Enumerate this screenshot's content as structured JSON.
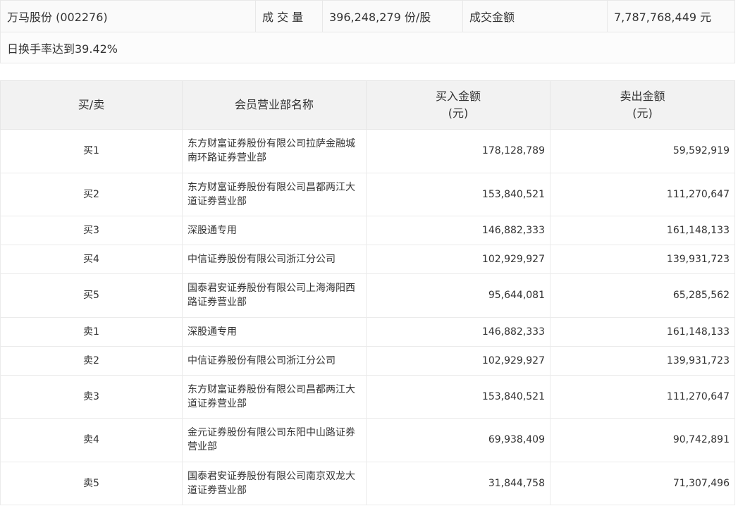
{
  "summary": {
    "stock": "万马股份 (002276)",
    "volume_label": "成 交 量",
    "volume_value": "396,248,279 份/股",
    "amount_label": "成交金额",
    "amount_value": "7,787,768,449 元",
    "reason": "日换手率达到39.42%"
  },
  "table": {
    "headers": {
      "side": "买/卖",
      "member": "会员营业部名称",
      "buy_line1": "买入金额",
      "buy_line2": "(元)",
      "sell_line1": "卖出金额",
      "sell_line2": "(元)"
    },
    "rows": [
      {
        "side": "买1",
        "member": "东方财富证券股份有限公司拉萨金融城南环路证券营业部",
        "buy": "178,128,789",
        "sell": "59,592,919"
      },
      {
        "side": "买2",
        "member": "东方财富证券股份有限公司昌都两江大道证券营业部",
        "buy": "153,840,521",
        "sell": "111,270,647"
      },
      {
        "side": "买3",
        "member": "深股通专用",
        "buy": "146,882,333",
        "sell": "161,148,133"
      },
      {
        "side": "买4",
        "member": "中信证券股份有限公司浙江分公司",
        "buy": "102,929,927",
        "sell": "139,931,723"
      },
      {
        "side": "买5",
        "member": "国泰君安证券股份有限公司上海海阳西路证券营业部",
        "buy": "95,644,081",
        "sell": "65,285,562"
      },
      {
        "side": "卖1",
        "member": "深股通专用",
        "buy": "146,882,333",
        "sell": "161,148,133"
      },
      {
        "side": "卖2",
        "member": "中信证券股份有限公司浙江分公司",
        "buy": "102,929,927",
        "sell": "139,931,723"
      },
      {
        "side": "卖3",
        "member": "东方财富证券股份有限公司昌都两江大道证券营业部",
        "buy": "153,840,521",
        "sell": "111,270,647"
      },
      {
        "side": "卖4",
        "member": "金元证券股份有限公司东阳中山路证券营业部",
        "buy": "69,938,409",
        "sell": "90,742,891"
      },
      {
        "side": "卖5",
        "member": "国泰君安证券股份有限公司南京双龙大道证券营业部",
        "buy": "31,844,758",
        "sell": "71,307,496"
      }
    ]
  }
}
